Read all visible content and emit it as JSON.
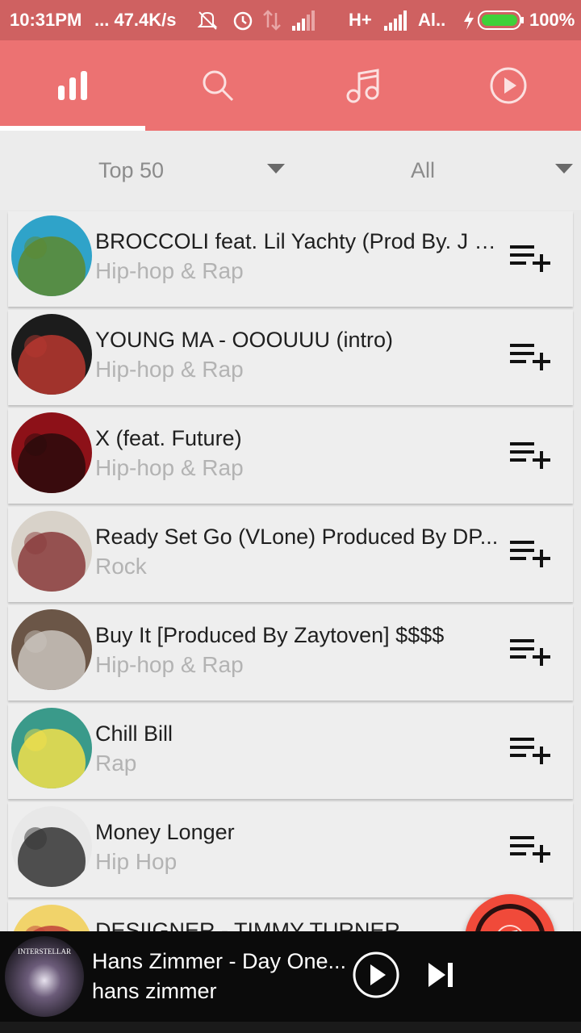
{
  "status_bar": {
    "time": "10:31PM",
    "speed": "... 47.4K/s",
    "network": "H+",
    "carrier": "Al..",
    "battery": "100%"
  },
  "tabs": [
    {
      "icon": "bar-chart-icon",
      "active": true
    },
    {
      "icon": "search-icon",
      "active": false
    },
    {
      "icon": "music-note-icon",
      "active": false
    },
    {
      "icon": "play-circle-icon",
      "active": false
    }
  ],
  "filters": {
    "chart": "Top 50",
    "genre": "All"
  },
  "songs": [
    {
      "title": "BROCCOLI feat. Lil Yachty (Prod By. J G...",
      "genre": "Hip-hop & Rap",
      "art_colors": [
        "#2fa3c9",
        "#5d8a2f"
      ]
    },
    {
      "title": "YOUNG MA - OOOUUU (intro)",
      "genre": "Hip-hop & Rap",
      "art_colors": [
        "#1c1c1c",
        "#b8372f"
      ]
    },
    {
      "title": "X (feat. Future)",
      "genre": "Hip-hop & Rap",
      "art_colors": [
        "#8d1118",
        "#2a0b0c"
      ]
    },
    {
      "title": "Ready Set Go (VLone) Produced By DP...",
      "genre": "Rock",
      "art_colors": [
        "#d8d2c9",
        "#8a3b3b"
      ]
    },
    {
      "title": "Buy It  [Produced By Zaytoven] $$$$",
      "genre": "Hip-hop & Rap",
      "art_colors": [
        "#6b5647",
        "#c9c3bd"
      ]
    },
    {
      "title": "Chill Bill",
      "genre": "Rap",
      "art_colors": [
        "#3a9a8a",
        "#f3e04a"
      ]
    },
    {
      "title": "Money Longer",
      "genre": "Hip Hop",
      "art_colors": [
        "#e8e8e8",
        "#333333"
      ]
    },
    {
      "title": "DESIIGNER - TIMMY TURNER",
      "genre": "",
      "art_colors": [
        "#f1d36a",
        "#c1423a"
      ]
    }
  ],
  "player": {
    "title": "Hans Zimmer - Day One...",
    "artist": "hans zimmer",
    "art_text": "INTERSTELLAR"
  },
  "colors": {
    "status_bar": "#cf6161",
    "tab_bar": "#ec7272",
    "fab": "#f04a3a"
  }
}
